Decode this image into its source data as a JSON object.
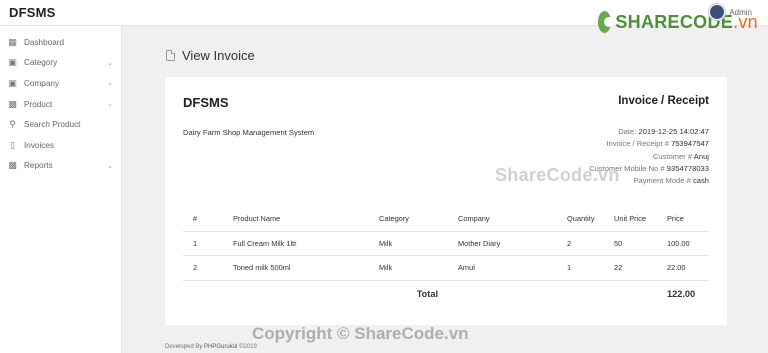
{
  "topbar": {
    "brand": "DFSMS",
    "user": "Admin"
  },
  "watermark": {
    "logo_text_main": "SHARECODE",
    "logo_text_suffix": ".vn",
    "mid": "ShareCode.vn",
    "bottom": "Copyright © ShareCode.vn"
  },
  "sidebar": {
    "items": [
      {
        "label": "Dashboard",
        "icon": "grid-icon",
        "has_children": false
      },
      {
        "label": "Category",
        "icon": "clipboard-icon",
        "has_children": true
      },
      {
        "label": "Company",
        "icon": "clipboard-icon",
        "has_children": true
      },
      {
        "label": "Product",
        "icon": "table-icon",
        "has_children": true
      },
      {
        "label": "Search Product",
        "icon": "search-icon",
        "has_children": false
      },
      {
        "label": "Invoices",
        "icon": "file-icon",
        "has_children": false
      },
      {
        "label": "Reports",
        "icon": "table-icon",
        "has_children": true
      }
    ]
  },
  "page": {
    "title": "View Invoice"
  },
  "invoice": {
    "brand": "DFSMS",
    "title": "Invoice / Receipt",
    "subtitle": "Dairy Farm Shop Management System",
    "meta": [
      {
        "label": "Date:",
        "value": "2019-12-25 14:02:47"
      },
      {
        "label": "Invoice / Receipt #",
        "value": "753947547"
      },
      {
        "label": "Customer #",
        "value": "Anuj"
      },
      {
        "label": "Customer Mobile No #",
        "value": "9354778033"
      },
      {
        "label": "Payment Mode #",
        "value": "cash"
      }
    ],
    "table": {
      "headers": [
        "#",
        "Product Name",
        "Category",
        "Company",
        "Quantity",
        "Unit Price",
        "Price"
      ],
      "rows": [
        [
          "1",
          "Full Cream Milk 1ltr",
          "Milk",
          "Mother Diary",
          "2",
          "50",
          "100.00"
        ],
        [
          "2",
          "Toned milk 500ml",
          "Milk",
          "Amul",
          "1",
          "22",
          "22.00"
        ]
      ],
      "total_label": "Total",
      "total_value": "122.00"
    }
  },
  "footer": {
    "prefix": "Developed By",
    "author": "PHPGurukul",
    "year": "©2019"
  }
}
